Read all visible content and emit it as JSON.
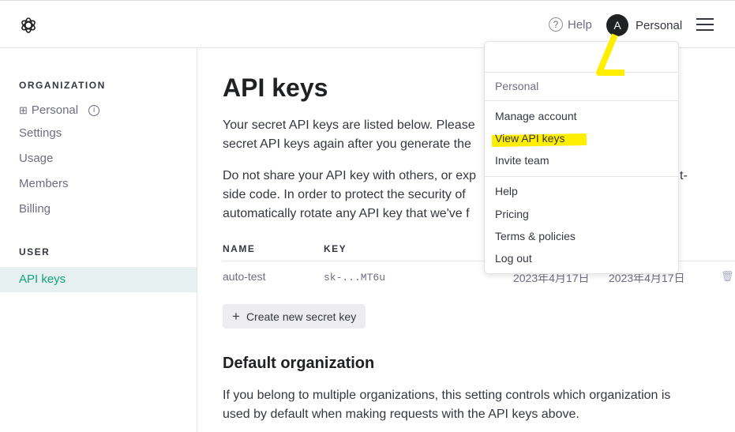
{
  "header": {
    "help_label": "Help",
    "avatar_initial": "A",
    "account_label": "Personal"
  },
  "sidebar": {
    "org_heading": "ORGANIZATION",
    "org_name": "Personal",
    "items": [
      {
        "label": "Settings"
      },
      {
        "label": "Usage"
      },
      {
        "label": "Members"
      },
      {
        "label": "Billing"
      }
    ],
    "user_heading": "USER",
    "active_item": "API keys"
  },
  "main": {
    "title": "API keys",
    "para1_lines": [
      "Your secret API keys are listed below. Please",
      "secret API keys again after you generate the"
    ],
    "para2_lines": [
      "Do not share your API key with others, or exp",
      "side code. In order to protect the security of",
      "automatically rotate any API key that we've f"
    ],
    "para2_right_fragment": "t-",
    "table": {
      "headers": [
        "NAME",
        "KEY"
      ],
      "rows": [
        {
          "name": "auto-test",
          "key": "sk-...MT6u",
          "created": "2023年4月17日",
          "last_used": "2023年4月17日"
        }
      ]
    },
    "create_button": "Create new secret key",
    "default_org_title": "Default organization",
    "default_org_lines": [
      "If you belong to multiple organizations, this setting controls which organization is",
      "used by default when making requests with the API keys above."
    ]
  },
  "dropdown": {
    "org_label": "Personal",
    "group1": [
      "Manage account",
      "View API keys",
      "Invite team"
    ],
    "group2": [
      "Help",
      "Pricing",
      "Terms & policies",
      "Log out"
    ]
  },
  "colors": {
    "accent": "#10a37f",
    "highlight": "#ffee00",
    "active_bg": "#e6f0f0"
  }
}
